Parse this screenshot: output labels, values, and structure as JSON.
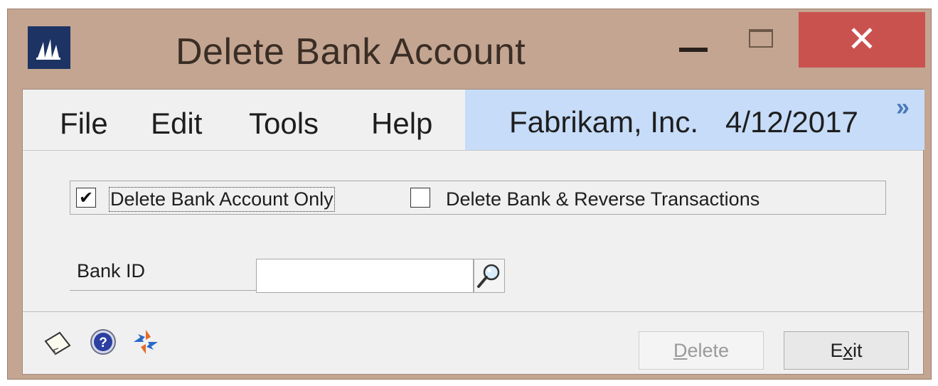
{
  "window": {
    "title": "Delete Bank Account",
    "close_glyph": "✕"
  },
  "menu": {
    "items": [
      "File",
      "Edit",
      "Tools",
      "Help"
    ],
    "company": "Fabrikam, Inc.",
    "date": "4/12/2017",
    "expand_glyph": "»"
  },
  "options": {
    "delete_only": {
      "label": "Delete Bank Account Only",
      "checked": true,
      "mark": "✔"
    },
    "delete_reverse": {
      "label": "Delete Bank & Reverse Transactions",
      "checked": false
    }
  },
  "bank_id": {
    "label": "Bank ID",
    "value": ""
  },
  "buttons": {
    "delete": {
      "label_underlined": "D",
      "label_rest": "elete",
      "enabled": false
    },
    "exit": {
      "label_first": "E",
      "label_underlined": "x",
      "label_rest": "it",
      "enabled": true
    }
  },
  "icons": {
    "app": "dynamics-logo-icon",
    "note": "note-icon",
    "help": "help-icon",
    "refresh": "refresh-icon",
    "lookup": "magnifier-icon"
  },
  "colors": {
    "title_bar": "#c3a591",
    "close_button": "#c9524f",
    "company_panel": "#c6dcf8",
    "app_icon": "#1c3364"
  }
}
